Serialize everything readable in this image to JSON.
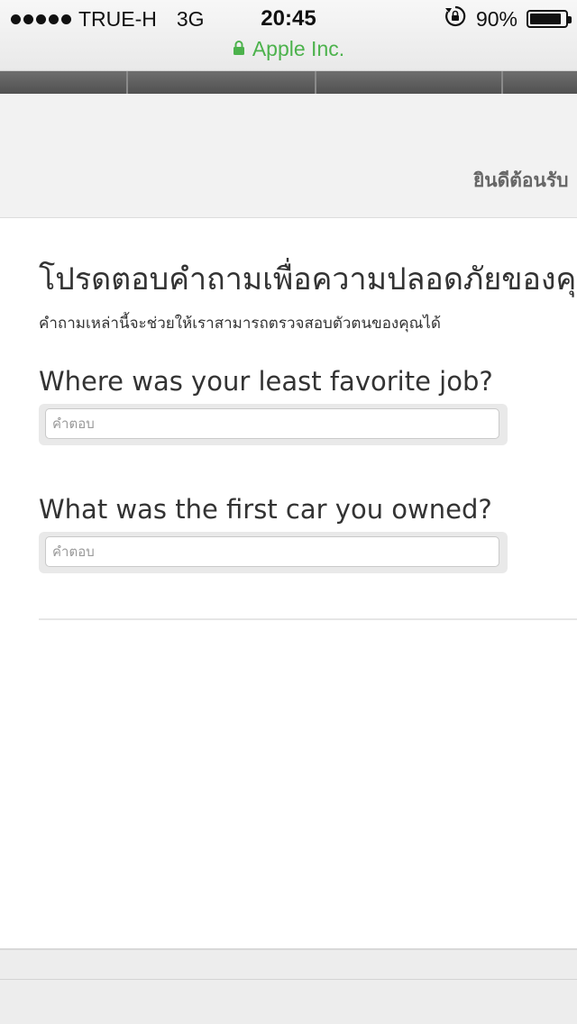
{
  "status_bar": {
    "carrier": "TRUE-H",
    "network": "3G",
    "time": "20:45",
    "battery_percent": "90%",
    "battery_level": 0.9
  },
  "url_bar": {
    "site_name": "Apple Inc."
  },
  "welcome": {
    "text": "ยินดีต้อนรับ"
  },
  "security": {
    "title": "โปรดตอบคำถามเพื่อความปลอดภัยของคุณ",
    "subtitle": "คำถามเหล่านี้จะช่วยให้เราสามารถตรวจสอบตัวตนของคุณได้",
    "questions": [
      {
        "question": "Where was your least favorite job?",
        "value": "",
        "placeholder": "คำตอบ"
      },
      {
        "question": "What was the first car you owned?",
        "value": "",
        "placeholder": "คำตอบ"
      }
    ]
  },
  "colors": {
    "secure_green": "#4cb24c",
    "nav_dark": "#5e5e5e"
  }
}
